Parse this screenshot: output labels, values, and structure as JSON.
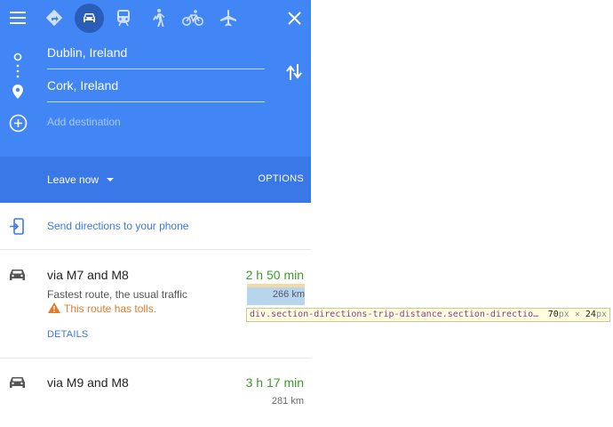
{
  "header": {
    "modes": [
      {
        "name": "best-route",
        "icon": "directions-icon"
      },
      {
        "name": "driving",
        "icon": "car-icon"
      },
      {
        "name": "transit",
        "icon": "train-icon"
      },
      {
        "name": "walking",
        "icon": "walk-icon"
      },
      {
        "name": "cycling",
        "icon": "bike-icon"
      },
      {
        "name": "flights",
        "icon": "plane-icon"
      }
    ],
    "selected_mode": "driving",
    "colors": {
      "primary": "#4285f4",
      "secondary": "#3b78e7"
    }
  },
  "inputs": {
    "origin": "Dublin, Ireland",
    "destination": "Cork, Ireland",
    "add_destination_placeholder": "Add destination"
  },
  "leave": {
    "label": "Leave now",
    "options_label": "OPTIONS"
  },
  "send": {
    "label": "Send directions to your phone"
  },
  "routes": [
    {
      "title": "via M7 and M8",
      "time": "2 h 50 min",
      "description": "Fastest route, the usual traffic",
      "distance": "266 km",
      "warning": "This route has tolls.",
      "details_label": "DETAILS"
    },
    {
      "title": "via M9 and M8",
      "time": "3 h 17 min",
      "distance": "281 km"
    }
  ],
  "devtools_tooltip": {
    "selector": "div.section-directions-trip-distance.section-directio…",
    "width": "70",
    "height": "24",
    "unit": "px",
    "times": "×"
  }
}
